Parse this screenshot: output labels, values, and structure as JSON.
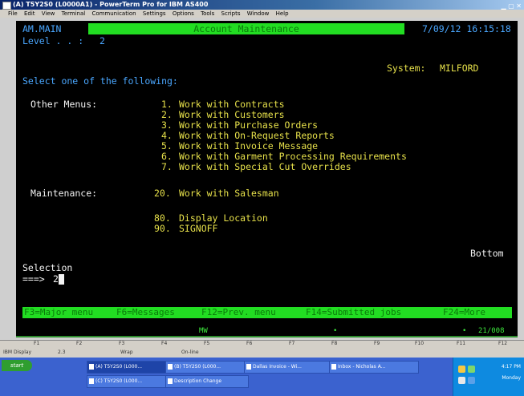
{
  "window": {
    "title": "(A) T5Y2S0 (L0000A1) - PowerTerm Pro for IBM AS400",
    "menu": [
      "File",
      "Edit",
      "View",
      "Terminal",
      "Communication",
      "Settings",
      "Options",
      "Tools",
      "Scripts",
      "Window",
      "Help"
    ]
  },
  "screen": {
    "program": "AM.MAIN",
    "level_label": "Level . . :",
    "level_value": "2",
    "title": "Account Maintenance",
    "datetime": "7/09/12 16:15:18",
    "system_label": "System:",
    "system_value": "MILFORD",
    "instruction": "Select one of the following:",
    "other_menus_label": "Other Menus:",
    "other_menus": [
      {
        "num": "1.",
        "label": "Work with Contracts"
      },
      {
        "num": "2.",
        "label": "Work with Customers"
      },
      {
        "num": "3.",
        "label": "Work with Purchase Orders"
      },
      {
        "num": "4.",
        "label": "Work with On-Request Reports"
      },
      {
        "num": "5.",
        "label": "Work with Invoice Message"
      },
      {
        "num": "6.",
        "label": "Work with Garment Processing Requirements"
      },
      {
        "num": "7.",
        "label": "Work with Special Cut Overrides"
      }
    ],
    "maintenance_label": "Maintenance:",
    "maintenance": [
      {
        "num": "20.",
        "label": "Work with Salesman"
      }
    ],
    "extra": [
      {
        "num": "80.",
        "label": "Display Location"
      },
      {
        "num": "90.",
        "label": "SIGNOFF"
      }
    ],
    "bottom_label": "Bottom",
    "selection_label": "Selection",
    "prompt": "===>",
    "input_value": "2",
    "function_keys": [
      "F3=Major menu",
      "F6=Messages",
      "F12=Prev. menu",
      "F14=Submitted jobs",
      "F24=More"
    ],
    "status_mode": "MW",
    "status_pos": "21/008"
  },
  "ruler_keys": [
    "F1",
    "F2",
    "F3",
    "F4",
    "F5",
    "F6",
    "F7",
    "F8",
    "F9",
    "F10",
    "F11",
    "F12"
  ],
  "statusbar": {
    "display": "IBM Display",
    "session": "2.3",
    "wrap": "Wrap",
    "online": "On-line"
  },
  "taskbar": {
    "start": "start",
    "buttons": [
      "(A) T5Y2S0 (L000...",
      "(B) T5Y2S0 (L000...",
      "Dallas Invoice - Wi...",
      "Inbox - Nicholas A...",
      "(C) T5Y2S0 (L000...",
      "Description Change"
    ],
    "clock": "4:17 PM",
    "day": "Monday"
  }
}
